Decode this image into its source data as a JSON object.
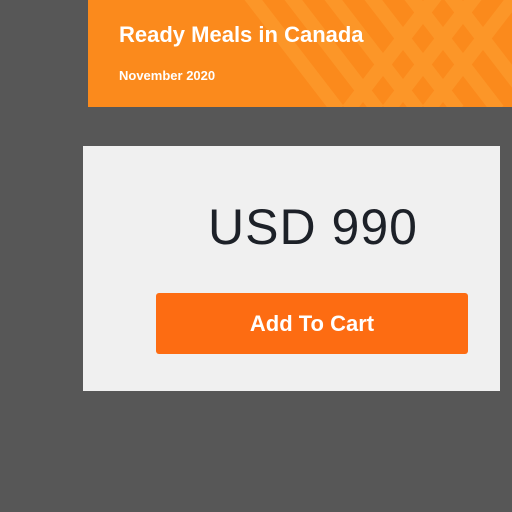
{
  "banner": {
    "title": "Ready Meals in Canada",
    "date": "November 2020"
  },
  "purchase": {
    "price": "USD 990",
    "add_to_cart_label": "Add To Cart"
  },
  "colors": {
    "page_background": "#575757",
    "banner_orange": "#fb8a1c",
    "card_background": "#f0f0f0",
    "button_orange": "#fd6c12",
    "price_text": "#1d2128"
  }
}
